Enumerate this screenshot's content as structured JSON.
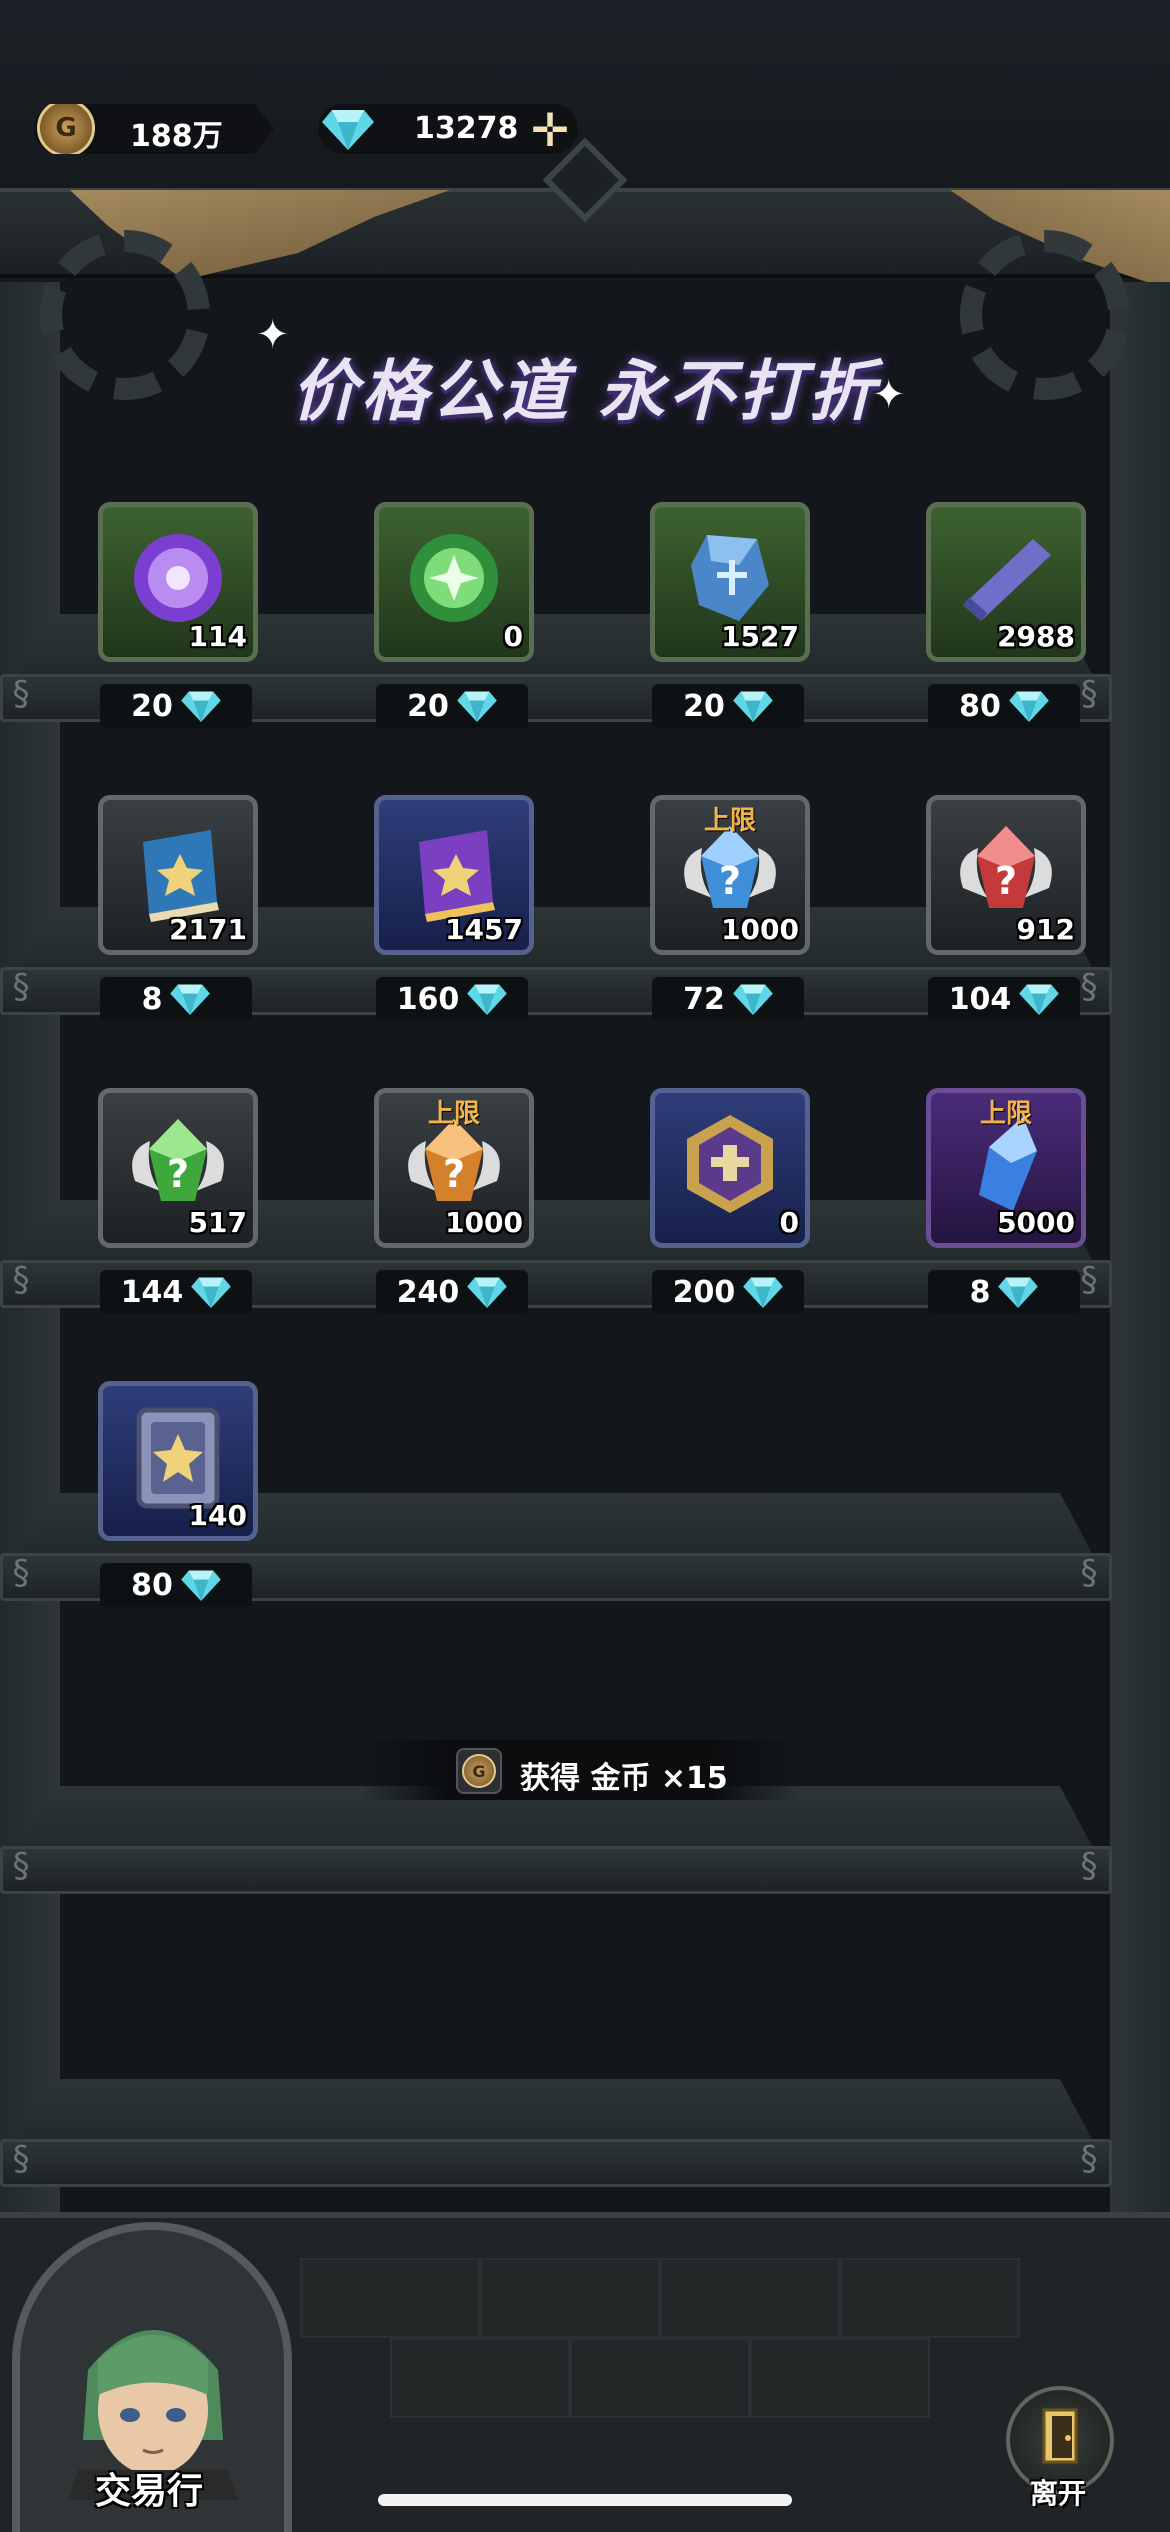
{
  "header": {
    "coins": "188万",
    "gems": "13278",
    "coin_symbol": "G",
    "add_symbol": "✛"
  },
  "banner": {
    "title": "价格公道 永不打折"
  },
  "items": [
    {
      "count": "114",
      "price": "20",
      "cap": "",
      "icon": "purple-orb-icon"
    },
    {
      "count": "0",
      "price": "20",
      "cap": "",
      "icon": "green-orb-icon"
    },
    {
      "count": "1527",
      "price": "20",
      "cap": "",
      "icon": "blue-rune-stone-icon"
    },
    {
      "count": "2988",
      "price": "80",
      "cap": "",
      "icon": "scroll-icon"
    },
    {
      "count": "2171",
      "price": "8",
      "cap": "",
      "icon": "blue-book-icon"
    },
    {
      "count": "1457",
      "price": "160",
      "cap": "",
      "icon": "purple-book-icon"
    },
    {
      "count": "1000",
      "price": "72",
      "cap": "上限",
      "icon": "blue-mystery-crystal-icon"
    },
    {
      "count": "912",
      "price": "104",
      "cap": "",
      "icon": "red-mystery-crystal-icon"
    },
    {
      "count": "517",
      "price": "144",
      "cap": "",
      "icon": "green-mystery-crystal-icon"
    },
    {
      "count": "1000",
      "price": "240",
      "cap": "上限",
      "icon": "orange-mystery-crystal-icon"
    },
    {
      "count": "0",
      "price": "200",
      "cap": "",
      "icon": "guild-emblem-icon"
    },
    {
      "count": "5000",
      "price": "8",
      "cap": "上限",
      "icon": "blue-crystal-shard-icon"
    },
    {
      "count": "140",
      "price": "80",
      "cap": "",
      "icon": "star-card-icon"
    }
  ],
  "toast": {
    "text": "获得 金币 ×15"
  },
  "footer": {
    "npc_name": "交易行",
    "exit_label": "离开"
  },
  "colors": {
    "cap_label": "#f2b54a",
    "gem": "#5fd7e6"
  }
}
